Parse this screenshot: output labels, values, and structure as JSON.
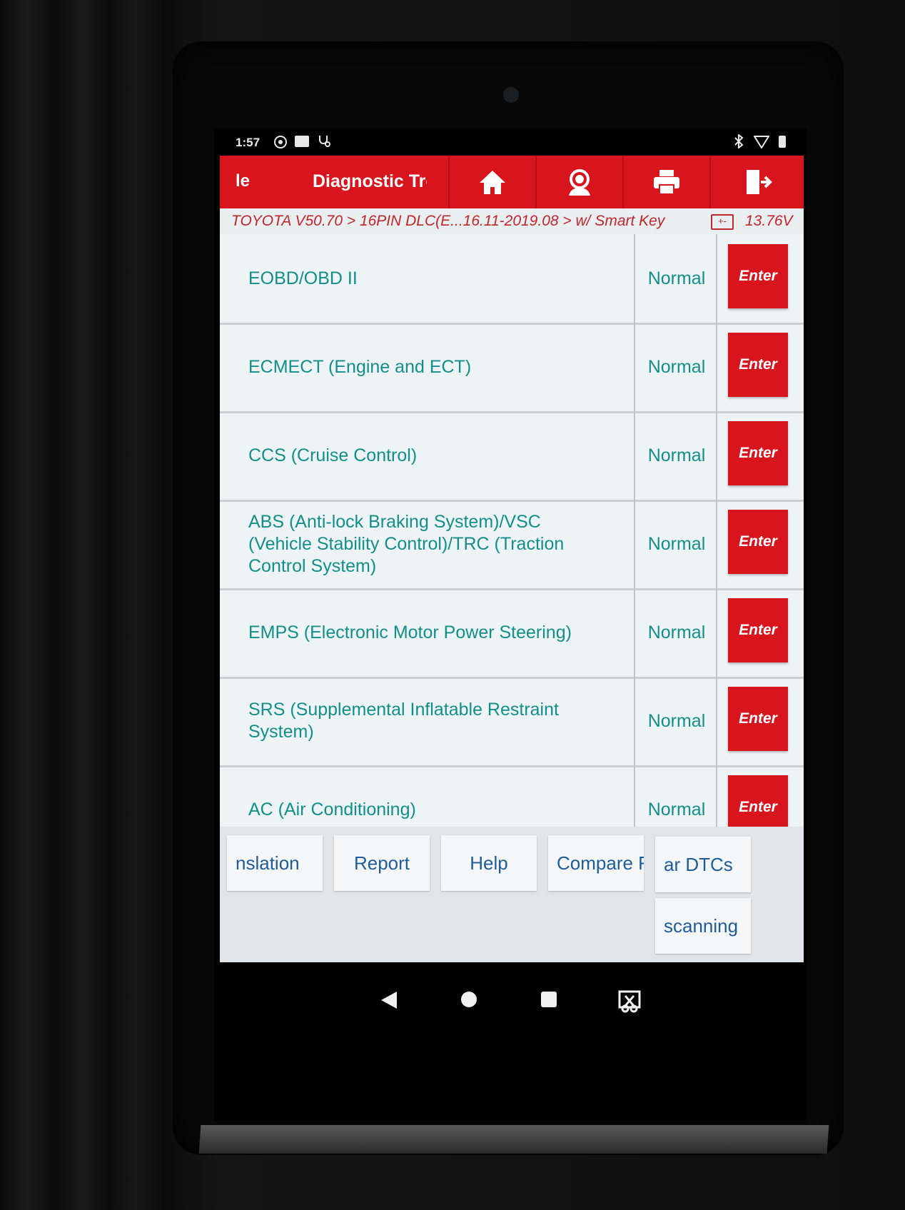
{
  "statusbar": {
    "time": "1:57"
  },
  "header": {
    "left_label": "le",
    "title": "Diagnostic Tro",
    "buttons": [
      "home-icon",
      "support-icon",
      "print-icon",
      "exit-icon"
    ]
  },
  "breadcrumb": {
    "path": "TOYOTA V50.70 > 16PIN DLC(E...16.11-2019.08 > w/ Smart Key",
    "battery_symbol": "+-",
    "voltage": "13.76V"
  },
  "systems": [
    {
      "name": "EOBD/OBD II",
      "status": "Normal",
      "action": "Enter"
    },
    {
      "name": "ECMECT (Engine and ECT)",
      "status": "Normal",
      "action": "Enter"
    },
    {
      "name": "CCS (Cruise Control)",
      "status": "Normal",
      "action": "Enter"
    },
    {
      "name": "ABS (Anti-lock Braking System)/VSC (Vehicle Stability Control)/TRC (Traction Control System)",
      "status": "Normal",
      "action": "Enter"
    },
    {
      "name": "EMPS (Electronic Motor Power Steering)",
      "status": "Normal",
      "action": "Enter"
    },
    {
      "name": "SRS (Supplemental Inflatable Restraint System)",
      "status": "Normal",
      "action": "Enter"
    },
    {
      "name": "AC (Air Conditioning)",
      "status": "Normal",
      "action": "Enter"
    }
  ],
  "toolbar": {
    "translation": "nslation",
    "report": "Report",
    "help": "Help",
    "compare": "Compare F",
    "clear_dtcs": "ar DTCs",
    "scanning": "scanning"
  },
  "colors": {
    "brand_red": "#d8141c",
    "text_teal": "#138f8a",
    "button_blue": "#1f5c9a"
  }
}
